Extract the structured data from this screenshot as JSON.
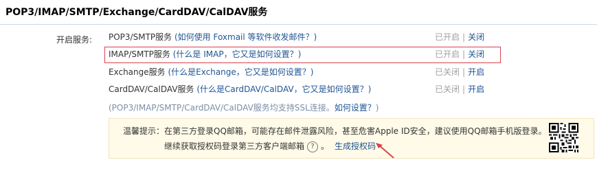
{
  "title": "POP3/IMAP/SMTP/Exchange/CardDAV/CalDAV服务",
  "open_service_label": "开启服务:",
  "services": [
    {
      "name": "POP3/SMTP服务",
      "help": "(如何使用 Foxmail 等软件收发邮件？)",
      "status": "已开启",
      "separator": "|",
      "action": "关闭"
    },
    {
      "name": "IMAP/SMTP服务",
      "help": "(什么是 IMAP，它又是如何设置？)",
      "status": "已开启",
      "separator": "|",
      "action": "关闭"
    },
    {
      "name": "Exchange服务",
      "help": "(什么是Exchange，它又是如何设置？)",
      "status": "已关闭",
      "separator": "|",
      "action": "开启"
    },
    {
      "name": "CardDAV/CalDAV服务",
      "help": "(什么是CardDAV/CalDAV，它又是如何设置？)",
      "status": "已关闭",
      "separator": "|",
      "action": "开启"
    }
  ],
  "ssl_note": {
    "text": "(POP3/IMAP/SMTP/CardDAV/CalDAV服务均支持SSL连接。",
    "link": "如何设置？",
    "close": ")"
  },
  "tip": {
    "line1": "温馨提示：在第三方登录QQ邮箱，可能存在邮件泄露风险，甚至危害Apple ID安全，建议使用QQ邮箱手机版登录。",
    "line2": "继续获取授权码登录第三方客户端邮箱",
    "help_icon": "?",
    "line2_end": "。",
    "generate_link": "生成授权码"
  },
  "colors": {
    "link": "#1e5494",
    "muted": "#a0a0a0",
    "highlight_border": "#d9414a",
    "tip_bg": "#fffbe8",
    "arrow": "#d9414a"
  },
  "icons": {
    "qr": "qr-code-icon",
    "arrow": "red-arrow-icon",
    "help": "question-circle-icon"
  }
}
